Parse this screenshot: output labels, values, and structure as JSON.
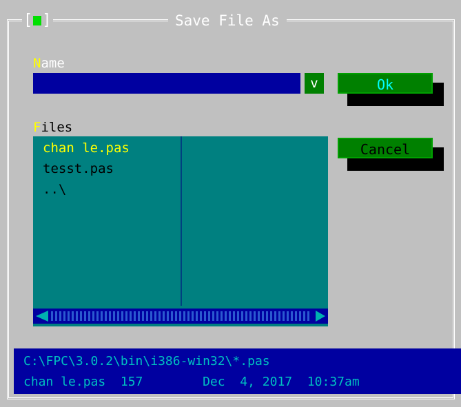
{
  "dialog": {
    "title": "Save File As",
    "close_box": "[",
    "close_box_end": "]"
  },
  "name_field": {
    "label_hot": "N",
    "label_rest": "ame",
    "value": "",
    "history_label": "v"
  },
  "files": {
    "label_hot": "F",
    "label_rest": "iles",
    "items": [
      "chan le.pas",
      "tesst.pas",
      "..\\"
    ],
    "selected_index": 0
  },
  "buttons": {
    "ok_label": "Ok",
    "cancel_label": "Cancel"
  },
  "info": {
    "path": "C:\\FPC\\3.0.2\\bin\\i386-win32\\*.pas",
    "file_line": "chan le.pas  157        Dec  4, 2017  10:37am"
  },
  "colors": {
    "dialog_bg": "#c0c0c0",
    "input_bg": "#0000a0",
    "list_bg": "#008080",
    "button_bg": "#008000",
    "hotkey": "#ffff00"
  }
}
